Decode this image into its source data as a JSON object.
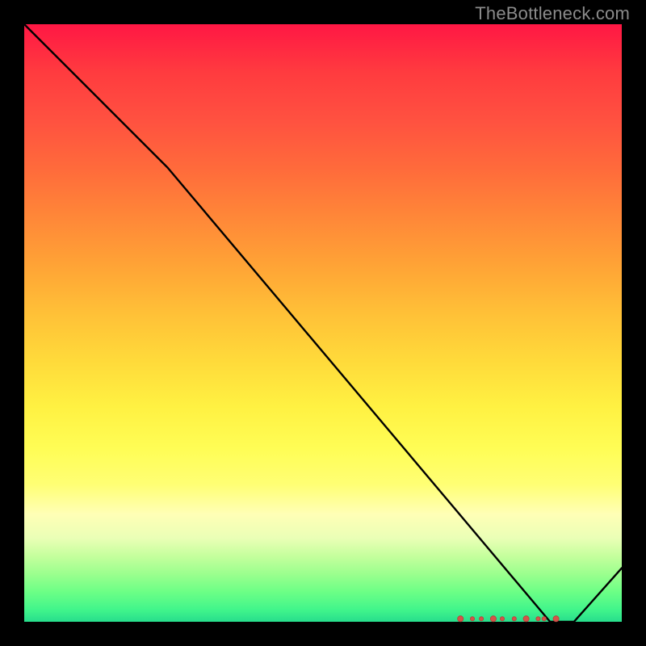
{
  "attribution": "TheBottleneck.com",
  "chart_data": {
    "type": "line",
    "title": "",
    "xlabel": "",
    "ylabel": "",
    "xlim": [
      0,
      100
    ],
    "ylim": [
      0,
      100
    ],
    "grid": false,
    "legend": false,
    "x": [
      0,
      24,
      88,
      92,
      100
    ],
    "y": [
      100,
      76,
      0,
      0,
      9
    ],
    "minimum_markers_x": [
      73,
      75,
      76.5,
      78.5,
      80,
      82,
      84,
      86,
      87,
      89
    ],
    "colors": {
      "top": "#ff1744",
      "bottom": "#27dd8c",
      "line": "#000000",
      "dot": "#d65249"
    }
  }
}
